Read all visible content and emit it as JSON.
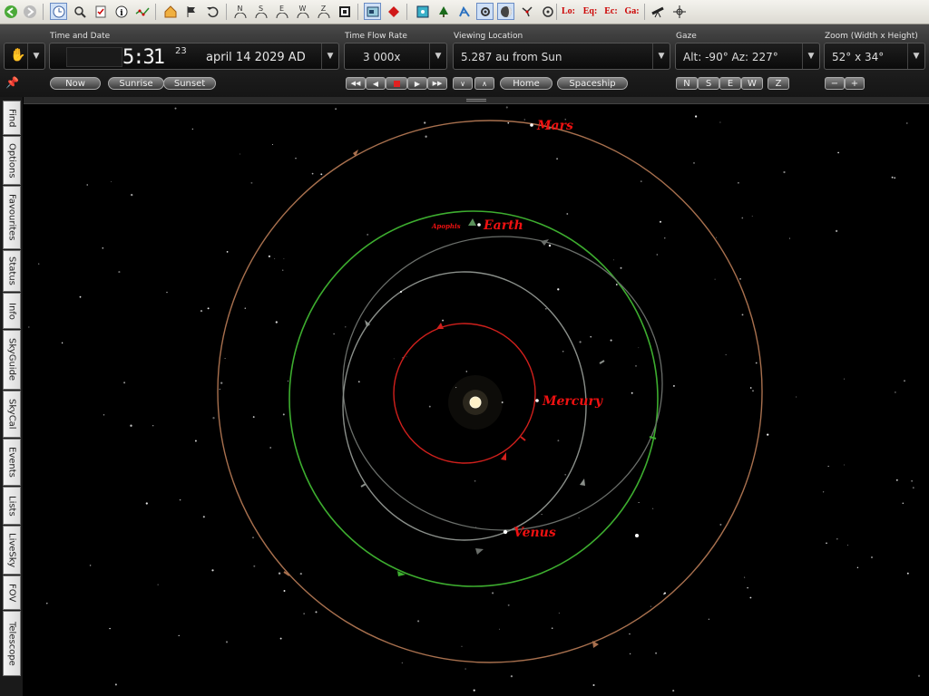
{
  "toolbar": {
    "icons": [
      "back-icon",
      "forward-icon",
      "time-icon",
      "find-icon",
      "checklist-icon",
      "info-icon",
      "stars-icon",
      "home-icon",
      "flag-icon",
      "undo-icon",
      "north-icon",
      "south-icon",
      "east-icon",
      "west-icon",
      "zenith-icon",
      "window-icon",
      "view-icon",
      "diamond-icon",
      "frame-icon",
      "tree-icon",
      "constellation-icon",
      "settings-icon",
      "moon-icon",
      "satellite-icon",
      "orbit-icon",
      "horizon-icon",
      "telescope-icon",
      "crosshair-icon"
    ],
    "dir_labels": [
      "N",
      "S",
      "E",
      "W",
      "Z"
    ],
    "grid_labels": [
      "Lo:",
      "Eq:",
      "Ec:",
      "Ga:"
    ]
  },
  "panel": {
    "time_label": "Time and Date",
    "clock": "5:31",
    "seconds": "23",
    "date": "april 14   2029 AD",
    "flow_label": "Time Flow Rate",
    "flow_value": "3 000x",
    "location_label": "Viewing Location",
    "location_value": "5.287 au from Sun",
    "gaze_label": "Gaze",
    "gaze_value": "Alt: -90° Az: 227°",
    "zoom_label": "Zoom (Width x Height)",
    "zoom_value": "52° x 34°",
    "buttons": {
      "now": "Now",
      "sunrise": "Sunrise",
      "sunset": "Sunset",
      "home": "Home",
      "spaceship": "Spaceship",
      "n": "N",
      "s": "S",
      "e": "E",
      "w": "W",
      "z": "Z"
    },
    "flow_controls": [
      "◀||",
      "◀",
      "■",
      "▶",
      "||▶"
    ]
  },
  "sidetabs": [
    "Find",
    "Options",
    "Favourites",
    "Status",
    "Info",
    "SkyGuide",
    "SkyCal",
    "Events",
    "Lists",
    "LiveSky",
    "FOV",
    "Telescope"
  ],
  "sky": {
    "planets": {
      "mars": "Mars",
      "earth": "Earth",
      "mercury": "Mercury",
      "venus": "Venus",
      "apophis": "Apophis"
    },
    "colors": {
      "mars_orbit": "#a8704e",
      "earth_orbit": "#3dad2f",
      "mercury_orbit": "#d0201c",
      "venus_orbit": "#8a8f8a",
      "apophis_orbit": "#6a6e6a",
      "label": "#e11111",
      "sun": "#fff1c8"
    }
  }
}
